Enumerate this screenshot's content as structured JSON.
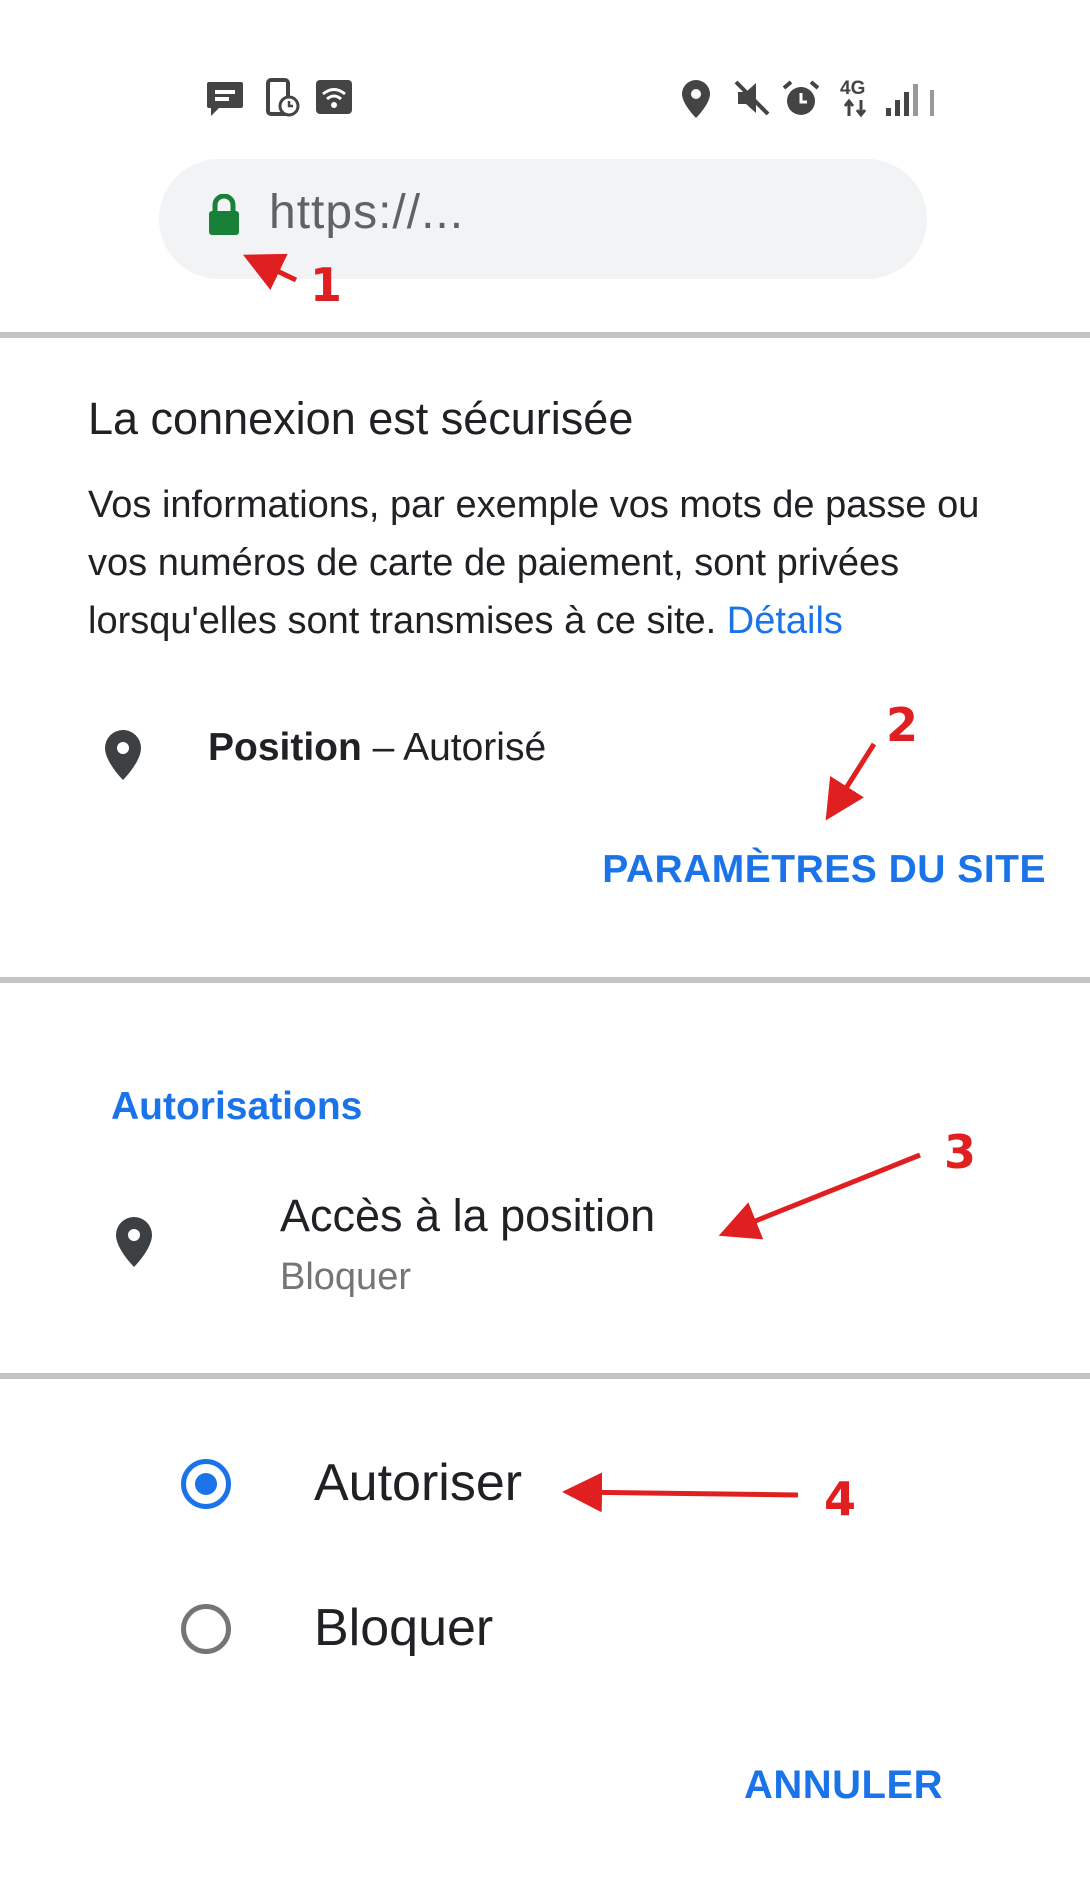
{
  "url_bar": {
    "url": "https://..."
  },
  "security": {
    "title": "La connexion est sécurisée",
    "description": "Vos informations, par exemple vos mots de passe ou vos numéros de carte de paiement, sont privées lorsqu'elles sont transmises à ce site.",
    "details_link": "Détails"
  },
  "permission_summary": {
    "name": "Position",
    "separator": " – ",
    "status": "Autorisé"
  },
  "site_settings_button": "PARAMÈTRES DU SITE",
  "permissions": {
    "section_label": "Autorisations",
    "item_title": "Accès à la position",
    "item_value": "Bloquer"
  },
  "dialog": {
    "options": [
      {
        "label": "Autoriser",
        "selected": true
      },
      {
        "label": "Bloquer",
        "selected": false
      }
    ],
    "cancel_label": "ANNULER"
  },
  "annotations": [
    "1",
    "2",
    "3",
    "4"
  ],
  "colors": {
    "accent": "#1a73e8",
    "lock_green": "#188038",
    "annotation_red": "#e02020"
  },
  "status_bar": {
    "icons": [
      "message-icon",
      "phone-clock-icon",
      "wifi-icon",
      "location-icon",
      "mute-icon",
      "alarm-icon",
      "4g-icon",
      "signal-icon"
    ],
    "network_label": "4G"
  }
}
